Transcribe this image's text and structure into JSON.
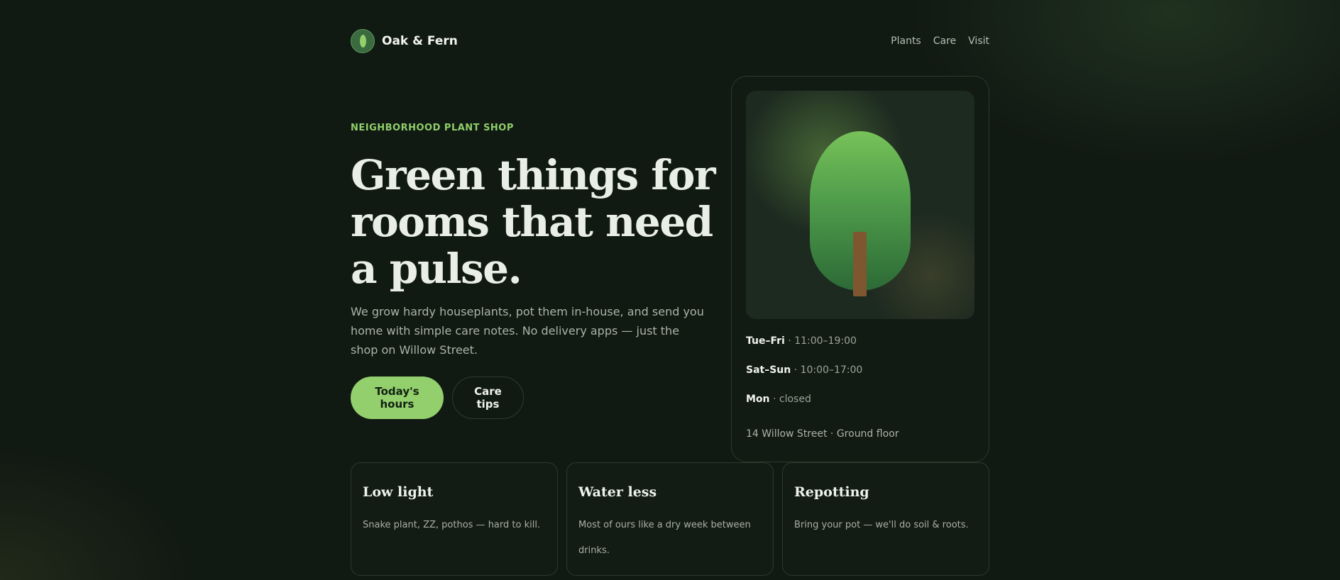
{
  "header": {
    "brand": "Oak & Fern",
    "logo_icon": "leaf-icon",
    "nav": [
      "Plants",
      "Care",
      "Visit"
    ]
  },
  "hero": {
    "eyebrow": "NEIGHBORHOOD PLANT SHOP",
    "title": "Green things for rooms that need a pulse.",
    "lead": "We grow hardy houseplants, pot them in-house, and send you home with simple care notes. No delivery apps — just the shop on Willow Street.",
    "primary_button": "Today's hours",
    "secondary_button": "Care tips"
  },
  "info_card": {
    "image_icon": "tree-icon",
    "hours": [
      {
        "day": "Tue–Fri",
        "time": " · 11:00–19:00"
      },
      {
        "day": "Sat–Sun",
        "time": " · 10:00–17:00"
      },
      {
        "day": "Mon",
        "time": " · closed"
      }
    ],
    "address": "14 Willow Street · Ground floor"
  },
  "tips": [
    {
      "title": "Low light",
      "text": "Snake plant, ZZ, pothos — hard to kill."
    },
    {
      "title": "Water less",
      "text": "Most of ours like a dry week between drinks."
    },
    {
      "title": "Repotting",
      "text": "Bring your pot — we'll do soil & roots."
    }
  ],
  "colors": {
    "background": "#111913",
    "accent": "#93cf6c",
    "text": "#e9efe7",
    "muted": "#aab5a8"
  }
}
